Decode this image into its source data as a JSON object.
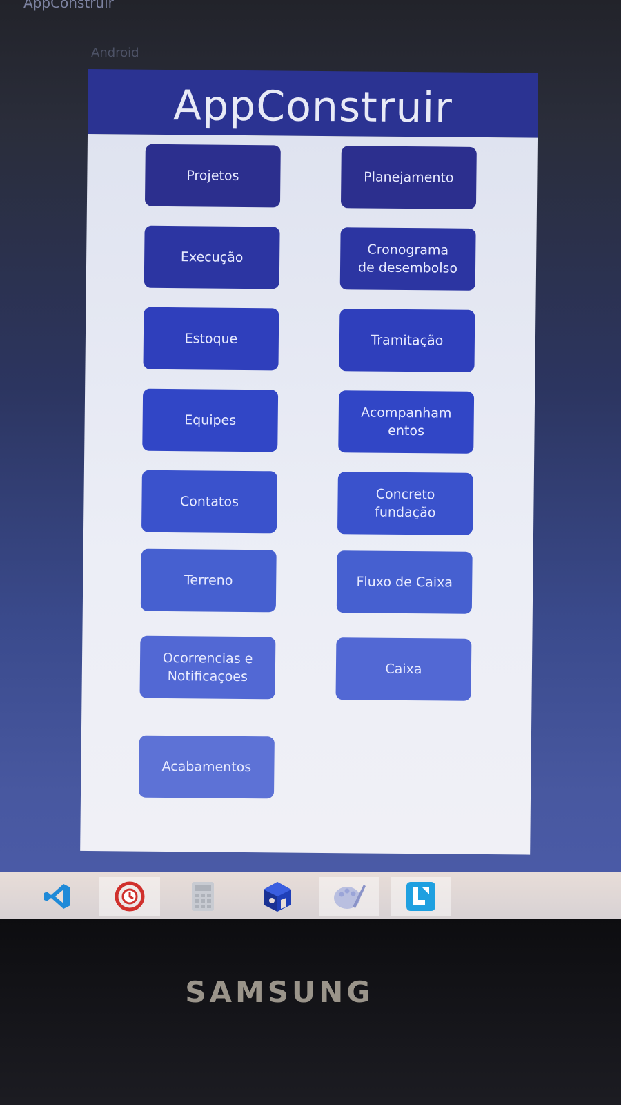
{
  "window": {
    "title": "AppConstruir",
    "device_label": "Android"
  },
  "app": {
    "header_title": "AppConstruir",
    "buttons_left": [
      "Projetos",
      "Execução",
      "Estoque",
      "Equipes",
      "Contatos",
      "Terreno",
      "Ocorrencias e\nNotificaçoes",
      "Acabamentos"
    ],
    "buttons_right": [
      "Planejamento",
      "Cronograma\nde desembolso",
      "Tramitação",
      "Acompanham\nentos",
      "Concreto\nfundação",
      "Fluxo de Caixa",
      "Caixa"
    ],
    "header_color": "#2b3392",
    "button_colors": [
      "#2c2f8e",
      "#2c35a2",
      "#2f3fbc",
      "#3146c6",
      "#3a52cc",
      "#4660d0",
      "#5268d4",
      "#5d72d6"
    ]
  },
  "taskbar": {
    "icons": [
      "vscode-icon",
      "restore-icon",
      "calculator-icon",
      "cube-app-icon",
      "paint-icon",
      "blue-app-icon"
    ]
  },
  "monitor": {
    "brand": "SAMSUNG"
  }
}
